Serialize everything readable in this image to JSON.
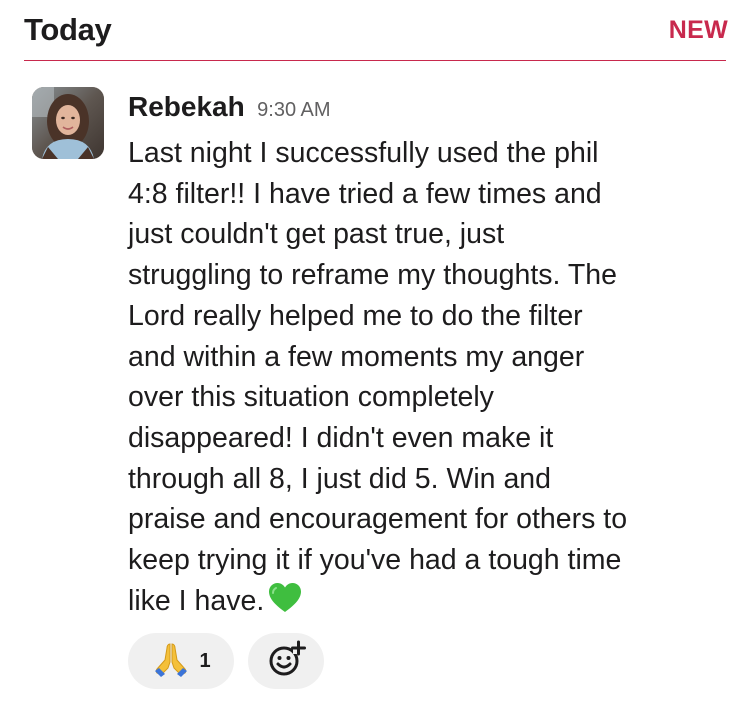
{
  "divider": {
    "day_label": "Today",
    "new_label": "NEW",
    "accent_color": "#c8294d"
  },
  "message": {
    "author": "Rebekah",
    "timestamp": "9:30 AM",
    "avatar_icon": "user-avatar-photo",
    "body": "Last night I successfully used the phil\n4:8 filter!! I have tried a few times and\njust couldn't get past true, just\nstruggling to reframe my thoughts.  The\nLord really helped me to do the filter\nand within a few moments my anger\nover this situation completely\ndisappeared! I didn't even make it\nthrough all 8, I just did 5. Win and\npraise and encouragement for others to\nkeep trying it if you've had a tough time\nlike I have.",
    "trailing_emoji": "green-heart-icon"
  },
  "reactions": [
    {
      "emoji": "folded-hands-icon",
      "count": "1"
    }
  ],
  "add_reaction_icon": "add-reaction-icon"
}
